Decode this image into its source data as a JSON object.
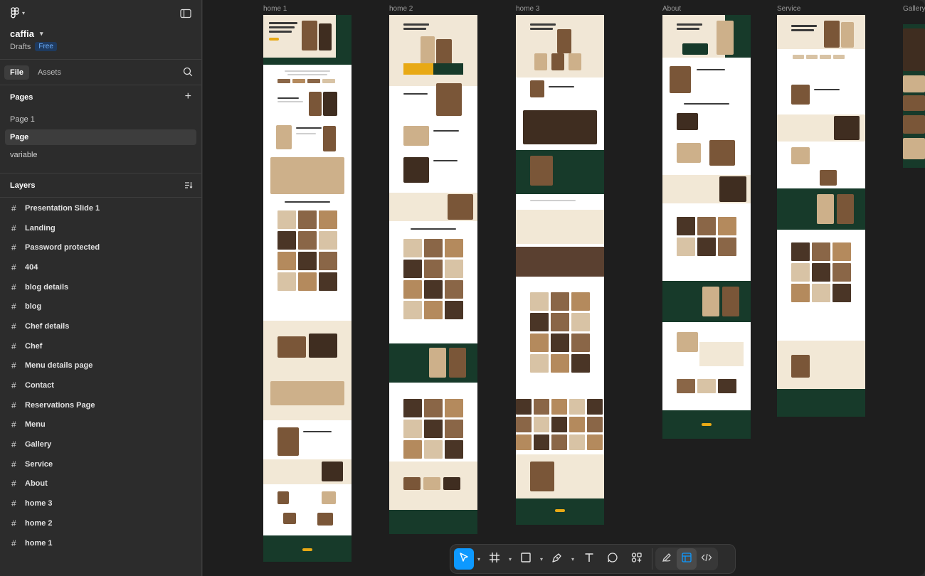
{
  "file": {
    "name": "caffia",
    "location": "Drafts",
    "plan_badge": "Free"
  },
  "tabs": [
    {
      "label": "File"
    },
    {
      "label": "Assets"
    }
  ],
  "pages": {
    "title": "Pages",
    "items": [
      {
        "label": "Page 1"
      },
      {
        "label": "Page"
      },
      {
        "label": "variable"
      }
    ],
    "selected": "Page"
  },
  "layers": {
    "title": "Layers",
    "items": [
      {
        "label": "Presentation Slide 1"
      },
      {
        "label": "Landing"
      },
      {
        "label": "Password protected"
      },
      {
        "label": "404"
      },
      {
        "label": "blog details"
      },
      {
        "label": "blog"
      },
      {
        "label": "Chef details"
      },
      {
        "label": "Chef"
      },
      {
        "label": "Menu details page"
      },
      {
        "label": "Contact"
      },
      {
        "label": "Reservations Page"
      },
      {
        "label": "Menu"
      },
      {
        "label": "Gallery"
      },
      {
        "label": "Service"
      },
      {
        "label": "About"
      },
      {
        "label": "home 3"
      },
      {
        "label": "home 2"
      },
      {
        "label": "home 1"
      }
    ]
  },
  "canvas": {
    "frames": [
      {
        "label": "home 1"
      },
      {
        "label": "home 2"
      },
      {
        "label": "home 3"
      },
      {
        "label": "About"
      },
      {
        "label": "Service"
      },
      {
        "label": "Gallery"
      }
    ]
  },
  "toolbar": {
    "tools": [
      {
        "name": "move-tool",
        "icon": "cursor-arrow-icon",
        "active": true
      },
      {
        "name": "frame-tool",
        "icon": "hash-frame-icon"
      },
      {
        "name": "shape-tool",
        "icon": "rectangle-icon"
      },
      {
        "name": "pen-tool",
        "icon": "pen-nib-icon"
      },
      {
        "name": "text-tool",
        "icon": "text-T-icon"
      },
      {
        "name": "comment-tool",
        "icon": "comment-bubble-icon"
      },
      {
        "name": "actions-tool",
        "icon": "shapes-plus-icon"
      },
      {
        "name": "draw-mode",
        "icon": "draw-pen-icon"
      },
      {
        "name": "design-mode",
        "icon": "design-layout-icon",
        "selected": true
      },
      {
        "name": "dev-mode",
        "icon": "code-brackets-icon"
      }
    ]
  },
  "colors": {
    "accent": "#0d99ff",
    "sidebar_bg": "#2c2c2c",
    "canvas_bg": "#1e1e1e",
    "badge_text": "#6fb1ff",
    "design_green": "#173a2a",
    "design_beige": "#f2e8d6",
    "design_yellow": "#e8a915"
  }
}
